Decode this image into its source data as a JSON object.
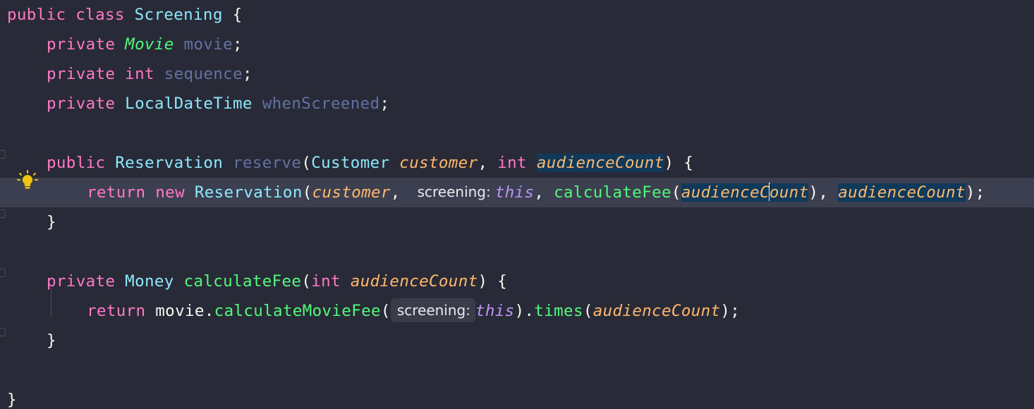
{
  "editor": {
    "language": "java",
    "current_line": 7,
    "lines": [
      {
        "n": 1,
        "indent": 0,
        "tokens": [
          {
            "t": "public class ",
            "k": "kw"
          },
          {
            "t": "Screening",
            "k": "type"
          },
          {
            "t": " {",
            "k": "plain"
          }
        ]
      },
      {
        "n": 2,
        "indent": 1,
        "tokens": [
          {
            "t": "private ",
            "k": "kw"
          },
          {
            "t": "Movie",
            "k": "type-it"
          },
          {
            "t": " movie",
            "k": "field"
          },
          {
            "t": ";",
            "k": "plain"
          }
        ]
      },
      {
        "n": 3,
        "indent": 1,
        "tokens": [
          {
            "t": "private int ",
            "k": "kw"
          },
          {
            "t": "sequence",
            "k": "field"
          },
          {
            "t": ";",
            "k": "plain"
          }
        ]
      },
      {
        "n": 4,
        "indent": 1,
        "tokens": [
          {
            "t": "private ",
            "k": "kw"
          },
          {
            "t": "LocalDateTime",
            "k": "type"
          },
          {
            "t": " whenScreened",
            "k": "field"
          },
          {
            "t": ";",
            "k": "plain"
          }
        ]
      },
      {
        "n": 5,
        "indent": 0,
        "tokens": []
      },
      {
        "n": 6,
        "indent": 1,
        "tokens": [
          {
            "t": "public ",
            "k": "kw"
          },
          {
            "t": "Reservation",
            "k": "type"
          },
          {
            "t": " reserve",
            "k": "field"
          },
          {
            "t": "(",
            "k": "plain"
          },
          {
            "t": "Customer",
            "k": "type"
          },
          {
            "t": " ",
            "k": "plain"
          },
          {
            "t": "customer",
            "k": "param"
          },
          {
            "t": ", ",
            "k": "plain"
          },
          {
            "t": "int",
            "k": "kw"
          },
          {
            "t": " ",
            "k": "plain"
          },
          {
            "t": "audienceCount",
            "k": "param",
            "hl": true
          },
          {
            "t": ") {",
            "k": "plain"
          }
        ]
      },
      {
        "n": 7,
        "indent": 2,
        "tokens": [
          {
            "t": "return new ",
            "k": "kw"
          },
          {
            "t": "Reservation",
            "k": "type"
          },
          {
            "t": "(",
            "k": "plain"
          },
          {
            "t": "customer",
            "k": "param"
          },
          {
            "t": ", ",
            "k": "plain"
          },
          {
            "hint": "screening:"
          },
          {
            "t": "this",
            "k": "this"
          },
          {
            "t": ", ",
            "k": "plain"
          },
          {
            "t": "calculateFee",
            "k": "fn"
          },
          {
            "t": "(",
            "k": "plain"
          },
          {
            "t": "audienceC",
            "k": "param",
            "hl": true
          },
          {
            "caret": true
          },
          {
            "t": "ount",
            "k": "param",
            "hl": true
          },
          {
            "t": "), ",
            "k": "plain"
          },
          {
            "t": "audienceCount",
            "k": "param",
            "hl": true
          },
          {
            "t": ");",
            "k": "plain"
          }
        ]
      },
      {
        "n": 8,
        "indent": 1,
        "tokens": [
          {
            "t": "}",
            "k": "plain"
          }
        ]
      },
      {
        "n": 9,
        "indent": 0,
        "tokens": []
      },
      {
        "n": 10,
        "indent": 1,
        "tokens": [
          {
            "t": "private ",
            "k": "kw"
          },
          {
            "t": "Money",
            "k": "type"
          },
          {
            "t": " ",
            "k": "plain"
          },
          {
            "t": "calculateFee",
            "k": "fn"
          },
          {
            "t": "(",
            "k": "plain"
          },
          {
            "t": "int",
            "k": "kw"
          },
          {
            "t": " ",
            "k": "plain"
          },
          {
            "t": "audienceCount",
            "k": "param"
          },
          {
            "t": ") {",
            "k": "plain"
          }
        ]
      },
      {
        "n": 11,
        "indent": 2,
        "tokens": [
          {
            "t": "return ",
            "k": "kw"
          },
          {
            "t": "movie.",
            "k": "plain"
          },
          {
            "t": "calculateMovieFee",
            "k": "fn"
          },
          {
            "t": "(",
            "k": "plain"
          },
          {
            "hint": "screening:",
            "boxed": true
          },
          {
            "t": "this",
            "k": "this"
          },
          {
            "t": ").",
            "k": "plain"
          },
          {
            "t": "times",
            "k": "fn"
          },
          {
            "t": "(",
            "k": "plain"
          },
          {
            "t": "audienceCount",
            "k": "param"
          },
          {
            "t": ");",
            "k": "plain"
          }
        ]
      },
      {
        "n": 12,
        "indent": 1,
        "tokens": [
          {
            "t": "}",
            "k": "plain"
          }
        ]
      },
      {
        "n": 13,
        "indent": 0,
        "tokens": []
      },
      {
        "n": 14,
        "indent": 0,
        "tokens": [
          {
            "t": "}",
            "k": "plain"
          }
        ]
      }
    ],
    "gutter": {
      "intention_icon": "lightbulb-icon"
    }
  }
}
